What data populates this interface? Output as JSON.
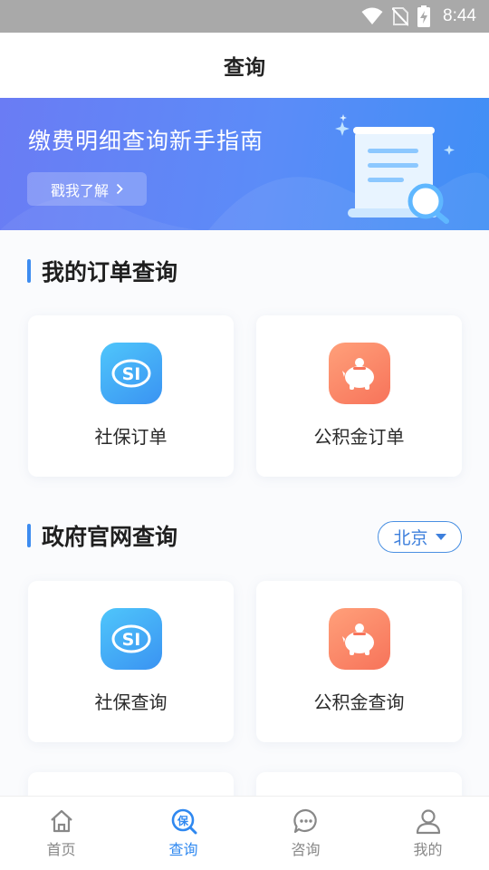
{
  "status_bar": {
    "time": "8:44",
    "icons": [
      "wifi-icon",
      "no-sim-icon",
      "battery-charging-icon"
    ]
  },
  "header": {
    "title": "查询"
  },
  "banner": {
    "title": "缴费明细查询新手指南",
    "button_label": "戳我了解",
    "illustration": "document-search-icon"
  },
  "orders_section": {
    "title": "我的订单查询",
    "cards": [
      {
        "label": "社保订单",
        "icon": "social-security-icon"
      },
      {
        "label": "公积金订单",
        "icon": "piggy-bank-icon"
      }
    ]
  },
  "gov_section": {
    "title": "政府官网查询",
    "city": "北京",
    "cards": [
      {
        "label": "社保查询",
        "icon": "social-security-icon"
      },
      {
        "label": "公积金查询",
        "icon": "piggy-bank-icon"
      }
    ]
  },
  "tabbar": {
    "active": "查询",
    "items": [
      {
        "label": "首页",
        "icon": "home-icon"
      },
      {
        "label": "查询",
        "icon": "query-icon"
      },
      {
        "label": "咨询",
        "icon": "chat-icon"
      },
      {
        "label": "我的",
        "icon": "user-icon"
      }
    ]
  },
  "colors": {
    "accent": "#2f88f0",
    "banner_start": "#6a7cf4",
    "banner_end": "#3f8ff5",
    "orange": "#f7735a"
  }
}
